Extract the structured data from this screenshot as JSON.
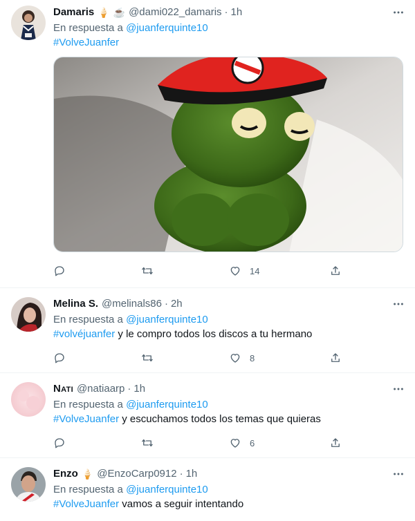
{
  "tweets": [
    {
      "name": "Damaris",
      "emojis": [
        "🍦",
        "☕"
      ],
      "handle": "@dami022_damaris",
      "separator": "·",
      "time": "1h",
      "reply_prefix": "En respuesta a",
      "reply_to": "@juanferquinte10",
      "hashtag": "#VolveJuanfer",
      "text": "",
      "likes": "14",
      "has_media": true
    },
    {
      "name": "Melina S.",
      "emojis": [],
      "handle": "@melinals86",
      "separator": "·",
      "time": "2h",
      "reply_prefix": "En respuesta a",
      "reply_to": "@juanferquinte10",
      "hashtag": "#volvéjuanfer",
      "text": " y le compro todos los discos a tu hermano",
      "likes": "8",
      "has_media": false
    },
    {
      "name": "Nati",
      "emojis": [],
      "handle": "@natiaarp",
      "separator": "·",
      "time": "1h",
      "reply_prefix": "En respuesta a",
      "reply_to": "@juanferquinte10",
      "hashtag": "#VolveJuanfer",
      "text": " y escuchamos todos los temas que quieras",
      "likes": "6",
      "has_media": false
    },
    {
      "name": "Enzo",
      "emojis": [
        "🍦"
      ],
      "handle": "@EnzoCarp0912",
      "separator": "·",
      "time": "1h",
      "reply_prefix": "En respuesta a",
      "reply_to": "@juanferquinte10",
      "hashtag": "#VolveJuanfer",
      "text": " vamos a seguir intentando",
      "likes": "",
      "has_media": false
    }
  ],
  "icons": {
    "more": "more-horizontal-icon",
    "reply": "reply-icon",
    "retweet": "retweet-icon",
    "like": "heart-icon",
    "share": "share-icon"
  },
  "colors": {
    "link": "#1d9bf0",
    "secondary_text": "#536471",
    "divider": "#eff3f4"
  }
}
